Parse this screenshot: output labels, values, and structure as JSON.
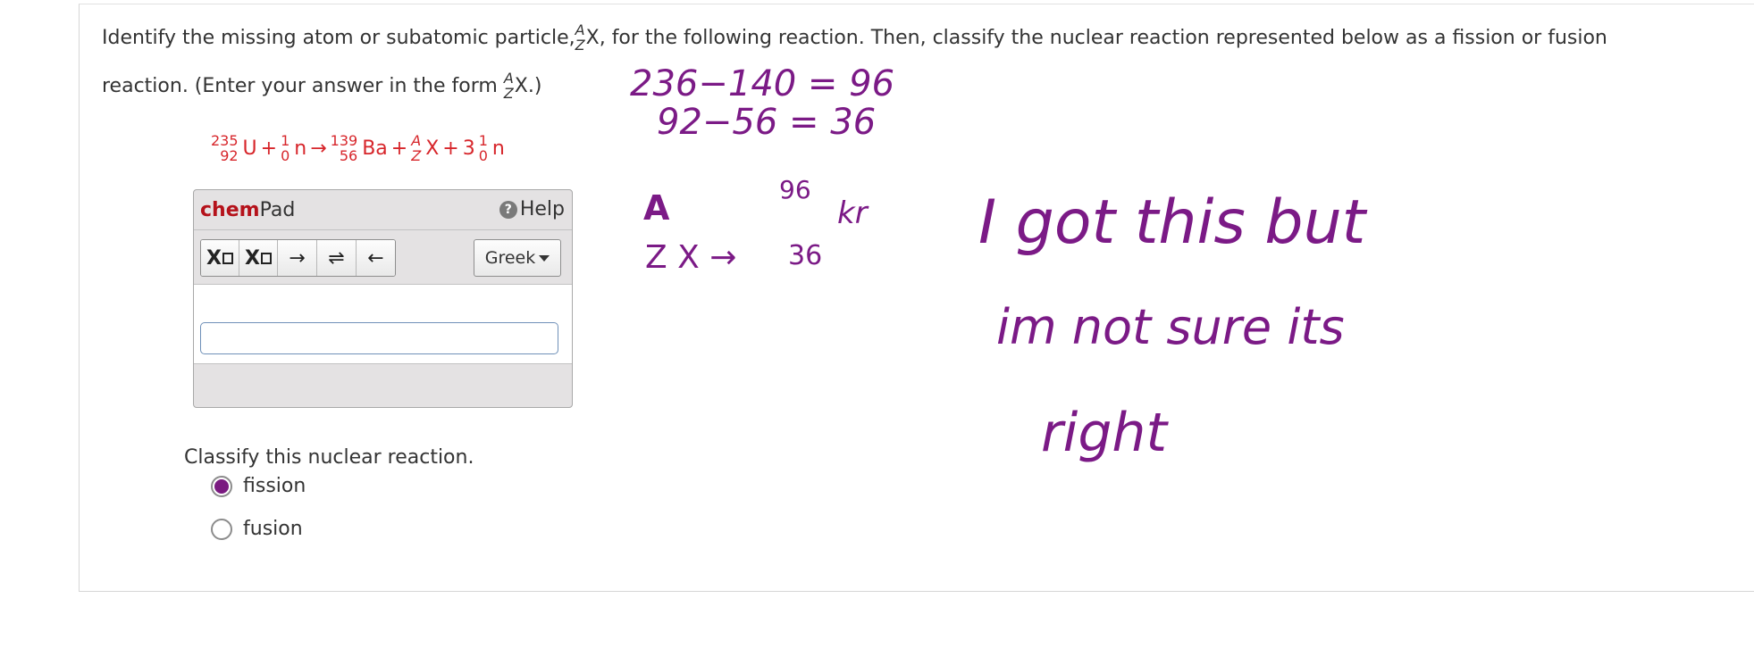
{
  "question": {
    "line1_before": "Identify the missing atom or subatomic particle,",
    "line1_symbol": {
      "mass": "A",
      "atomic": "Z",
      "element": "X"
    },
    "line1_after": ", for the following reaction. Then, classify the nuclear reaction represented below as a fission or fusion",
    "line2_before": "reaction. (Enter your answer in the form",
    "line2_symbol": {
      "mass": "A",
      "atomic": "Z",
      "element": "X"
    },
    "line2_after": ".)"
  },
  "equation": {
    "t1": {
      "mass": "235",
      "atomic": "92",
      "element": "U"
    },
    "plus1": "+",
    "t2": {
      "mass": "1",
      "atomic": "0",
      "element": "n"
    },
    "arrow": "→",
    "t3": {
      "mass": "139",
      "atomic": "56",
      "element": "Ba"
    },
    "plus2": "+",
    "t4": {
      "mass": "A",
      "atomic": "Z",
      "element": "X"
    },
    "plus3": "+",
    "coef": "3",
    "t5": {
      "mass": "1",
      "atomic": "0",
      "element": "n"
    }
  },
  "chempad": {
    "brand_bold": "chem",
    "brand_rest": "Pad",
    "help_label": "Help",
    "help_glyph": "?",
    "toolbar": {
      "sub_x": "X",
      "sup_x": "X",
      "arrow_right": "→",
      "equilibrium": "⇌",
      "arrow_left": "←",
      "greek_label": "Greek"
    },
    "input_value": ""
  },
  "classify": {
    "prompt": "Classify this nuclear reaction.",
    "options": [
      {
        "label": "fission",
        "selected": true
      },
      {
        "label": "fusion",
        "selected": false
      }
    ]
  },
  "handwriting": {
    "eq1": "236−140 = 96",
    "eq2": "92−56 = 36",
    "mass_letter": "A",
    "symbol": "Z X →",
    "result_mass": "96",
    "result_atomic": "36",
    "result_element": "kr",
    "note_line1": "I got this but",
    "note_line2": "im not sure its",
    "note_line3": "right"
  },
  "colors": {
    "equation_red": "#d7262b",
    "brand_red": "#b5121b",
    "ink_purple": "#7b1a86"
  }
}
